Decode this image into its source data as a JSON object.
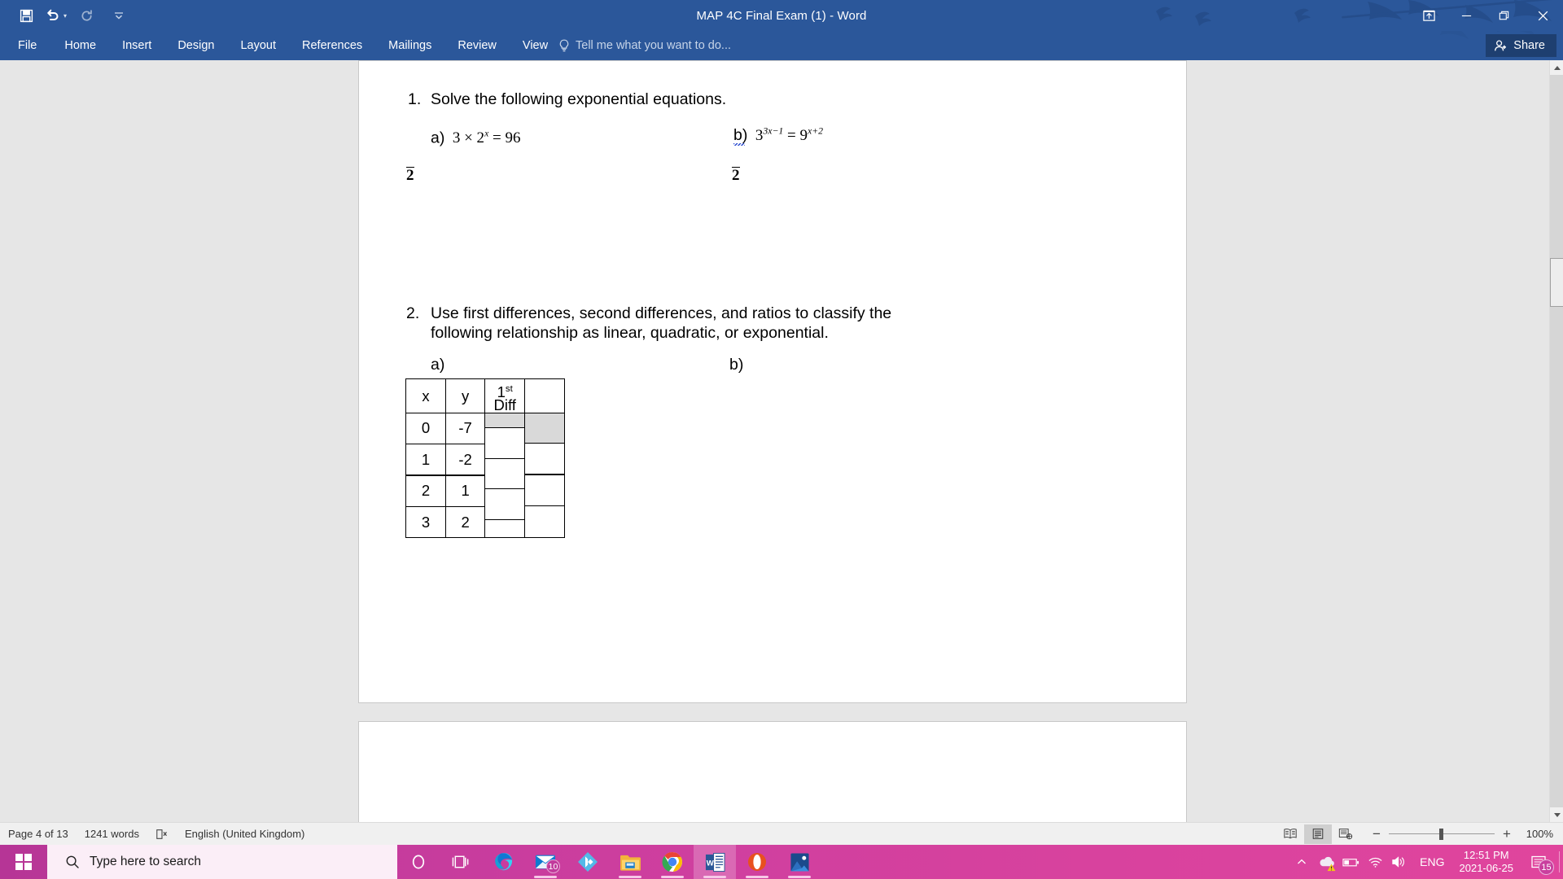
{
  "window": {
    "title": "MAP 4C Final Exam (1) - Word",
    "quick_access": [
      "save-icon",
      "undo-icon",
      "redo-icon",
      "customize-qat-icon"
    ],
    "controls": {
      "ribbon_display_options": "ribbon-display-options-icon",
      "minimize": "minimize-icon",
      "restore": "restore-icon",
      "close": "close-icon"
    }
  },
  "ribbon": {
    "tabs": [
      "File",
      "Home",
      "Insert",
      "Design",
      "Layout",
      "References",
      "Mailings",
      "Review",
      "View"
    ],
    "tell_me": "Tell me what you want to do...",
    "tell_me_icon": "lightbulb-icon",
    "share_label": "Share",
    "share_icon": "person-add-icon"
  },
  "document": {
    "questions": [
      {
        "number": "1.",
        "text": "Solve the following exponential equations.",
        "parts": [
          {
            "label": "a)",
            "expr_html": "3 &times; 2<sup>x</sup> = 96",
            "answer_mark": "2"
          },
          {
            "label": "b)",
            "expr_html": "3<sup>3x−1</sup> = 9<sup>x+2</sup>",
            "answer_mark": "2",
            "spellcheck_underline": true
          }
        ]
      },
      {
        "number": "2.",
        "text": "Use first differences, second differences, and ratios to classify the following relationship as linear, quadratic, or exponential.",
        "parts": [
          {
            "label": "a)"
          },
          {
            "label": "b)"
          }
        ]
      }
    ],
    "table": {
      "headers": [
        "x",
        "y",
        "1st Diff",
        ""
      ],
      "header_sup": "st",
      "rows": [
        {
          "x": "0",
          "y": "-7"
        },
        {
          "x": "1",
          "y": "-2"
        },
        {
          "x": "2",
          "y": "1"
        },
        {
          "x": "3",
          "y": "2"
        }
      ],
      "diff_cells": [
        "",
        "",
        "",
        "",
        ""
      ],
      "ratio_cells": [
        "",
        "",
        "",
        ""
      ],
      "shaded_cells": [
        "diff-0",
        "ratio-0"
      ]
    }
  },
  "statusbar": {
    "page": "Page 4 of 13",
    "words": "1241 words",
    "proofing_icon": "proofing-errors-icon",
    "language": "English (United Kingdom)",
    "views": [
      {
        "name": "read-mode",
        "icon": "read-mode-icon",
        "active": false
      },
      {
        "name": "print-layout",
        "icon": "print-layout-icon",
        "active": true
      },
      {
        "name": "web-layout",
        "icon": "web-layout-icon",
        "active": false
      }
    ],
    "zoom_out": "−",
    "zoom_in": "+",
    "zoom_level": "100%"
  },
  "taskbar": {
    "start_icon": "windows-start-icon",
    "search_placeholder": "Type here to search",
    "search_icon": "search-icon",
    "items": [
      {
        "name": "cortana-icon",
        "running": false
      },
      {
        "name": "task-view-icon",
        "running": false
      },
      {
        "name": "microsoft-edge-icon",
        "running": false
      },
      {
        "name": "mail-icon",
        "running": true,
        "badge": "10"
      },
      {
        "name": "kodi-icon",
        "running": false
      },
      {
        "name": "file-explorer-icon",
        "running": true
      },
      {
        "name": "google-chrome-icon",
        "running": true
      },
      {
        "name": "microsoft-word-icon",
        "running": true,
        "active": true
      },
      {
        "name": "opera-gx-icon",
        "running": true
      },
      {
        "name": "photos-icon",
        "running": true
      }
    ],
    "tray": {
      "overflow_icon": "chevron-up-icon",
      "onedrive_icon": "onedrive-warning-icon",
      "battery_icon": "battery-icon",
      "wifi_icon": "wifi-icon",
      "volume_icon": "volume-icon",
      "language": "ENG",
      "time": "12:51 PM",
      "date": "2021-06-25",
      "notification_icon": "notifications-icon",
      "notification_badge": "15"
    }
  },
  "colors": {
    "word_blue": "#2b579a",
    "share_bg": "#1e3f70",
    "taskbar_pink": "#c93f9e",
    "page_bg": "#e6e6e6",
    "shaded_cell": "#d9d9d9"
  }
}
